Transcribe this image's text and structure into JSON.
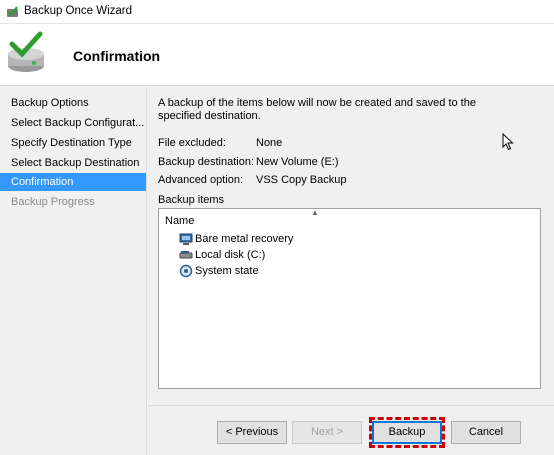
{
  "window": {
    "title": "Backup Once Wizard"
  },
  "header": {
    "title": "Confirmation"
  },
  "sidebar": {
    "items": [
      {
        "label": "Backup Options",
        "state": "normal"
      },
      {
        "label": "Select Backup Configurat...",
        "state": "normal"
      },
      {
        "label": "Specify Destination Type",
        "state": "normal"
      },
      {
        "label": "Select Backup Destination",
        "state": "normal"
      },
      {
        "label": "Confirmation",
        "state": "active"
      },
      {
        "label": "Backup Progress",
        "state": "disabled"
      }
    ]
  },
  "main": {
    "intro": "A backup of the items below will now be created and saved to the specified destination.",
    "details": [
      {
        "label": "File excluded:",
        "value": "None"
      },
      {
        "label": "Backup destination:",
        "value": "New Volume (E:)"
      },
      {
        "label": "Advanced option:",
        "value": "VSS Copy Backup"
      }
    ],
    "items_label": "Backup items",
    "column_header": "Name",
    "items": [
      {
        "label": "Bare metal recovery",
        "icon": "bare-metal-recovery-icon"
      },
      {
        "label": "Local disk (C:)",
        "icon": "disk-drive-icon"
      },
      {
        "label": "System state",
        "icon": "system-state-icon"
      }
    ]
  },
  "buttons": {
    "previous": "< Previous",
    "next": "Next >",
    "backup": "Backup",
    "cancel": "Cancel"
  },
  "colors": {
    "selection": "#3399ff",
    "highlight_border": "#cc0000",
    "primary_border": "#0078d7"
  }
}
